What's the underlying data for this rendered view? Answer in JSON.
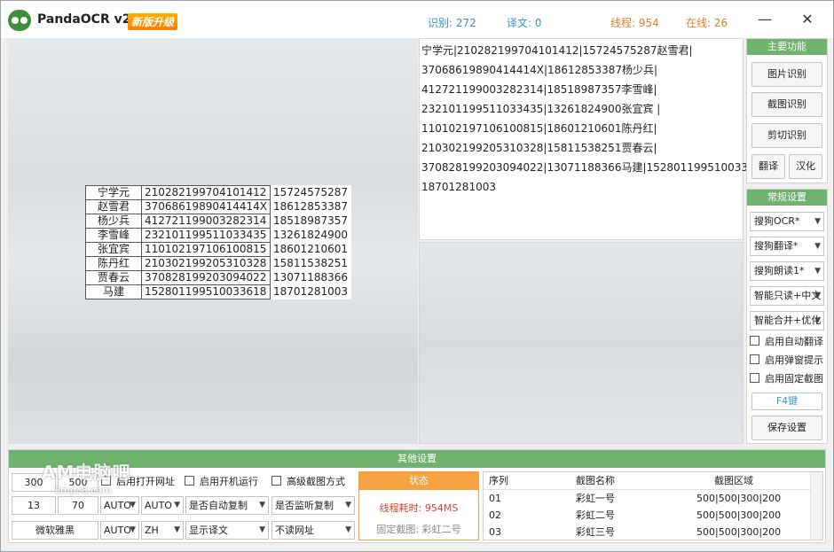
{
  "titlebar": {
    "app_title": "PandaOCR v2.4",
    "badge": "新版升级",
    "recognized": "识别: 272",
    "translated": "译文: 0",
    "threads": "线程: 954",
    "online": "在线: 26",
    "minimize_glyph": "—",
    "close_glyph": "✕"
  },
  "ocr_table": {
    "rows": [
      {
        "name": "宁学元",
        "id": "210282199704101412",
        "phone": "15724575287"
      },
      {
        "name": "赵雪君",
        "id": "37068619890414414X",
        "phone": "18612853387"
      },
      {
        "name": "杨少兵",
        "id": "412721199003282314",
        "phone": "18518987357"
      },
      {
        "name": "李雪峰",
        "id": "232101199511033435",
        "phone": "13261824900"
      },
      {
        "name": "张宜宾",
        "id": "110102197106100815",
        "phone": "18601210601"
      },
      {
        "name": "陈丹红",
        "id": "210302199205310328",
        "phone": "15811538251"
      },
      {
        "name": "贾春云",
        "id": "370828199203094022",
        "phone": "13071188366"
      },
      {
        "name": "马建",
        "id": "152801199510033618",
        "phone": "18701281003"
      }
    ]
  },
  "ocr_text_lines": [
    "宁学元|210282199704101412|15724575287赵雪君|",
    "37068619890414414X|18612853387杨少兵|",
    "412721199003282314|18518987357李雪峰|",
    "232101199511033435|13261824900张宜宾 |",
    "110102197106100815|18601210601陈丹红|",
    "210302199205310328|15811538251贾春云|",
    "370828199203094022|13071188366马建|152801199510033618",
    "18701281003"
  ],
  "main_functions": {
    "header": "主要功能",
    "image_ocr": "图片识别",
    "screenshot_ocr": "截图识别",
    "clipboard_ocr": "剪切识别",
    "translate": "翻译",
    "localize": "汉化"
  },
  "general_settings": {
    "header": "常规设置",
    "ocr_engine": "搜狗OCR*",
    "translate_engine": "搜狗翻译*",
    "read_engine": "搜狗朗读1*",
    "read_mode": "智能只读+中文",
    "merge_mode": "智能合并+优化",
    "auto_translate": "启用自动翻译",
    "popup_tip": "启用弹窗提示",
    "fixed_capture": "启用固定截图",
    "hotkey": "F4键",
    "save": "保存设置"
  },
  "other_settings": {
    "header": "其他设置",
    "width": "300",
    "height": "500",
    "open_url": "启用打开网址",
    "startup": "启用开机运行",
    "advanced_capture": "高级截图方式",
    "val_13": "13",
    "val_70": "70",
    "auto1": "AUTO",
    "auto2": "AUTO",
    "auto_copy": "是否自动复制",
    "listen_copy": "是否监听复制",
    "font": "微软雅黑",
    "auto3": "AUTO",
    "lang": "ZH",
    "show_translation": "显示译文",
    "no_url": "不读网址"
  },
  "status": {
    "header": "状态",
    "line1": "线程耗时: 954MS",
    "line2": "固定截图: 彩虹二号"
  },
  "capture_list": {
    "headers": [
      "序列",
      "截图名称",
      "截图区域"
    ],
    "rows": [
      {
        "seq": "01",
        "name": "彩虹一号",
        "area": "500|500|300|200"
      },
      {
        "seq": "02",
        "name": "彩虹二号",
        "area": "500|500|300|200"
      },
      {
        "seq": "03",
        "name": "彩虹三号",
        "area": "500|500|300|200"
      }
    ]
  },
  "watermark": {
    "main": "AM电脑吧",
    "sub": "3mpc8.com"
  }
}
